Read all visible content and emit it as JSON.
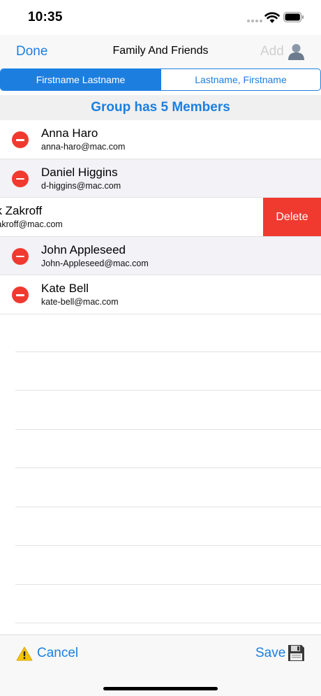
{
  "status_bar": {
    "time": "10:35"
  },
  "nav": {
    "done_label": "Done",
    "title": "Family And Friends",
    "add_label": "Add"
  },
  "sort_segments": [
    {
      "label": "Firstname Lastname",
      "selected": true
    },
    {
      "label": "Lastname, Firstname",
      "selected": false
    }
  ],
  "group": {
    "header": "Group has 5 Members"
  },
  "members": [
    {
      "name": "Anna Haro",
      "email": "anna-haro@mac.com"
    },
    {
      "name": "Daniel Higgins",
      "email": "d-higgins@mac.com"
    },
    {
      "name": "nk Zakroff",
      "email": "-zakroff@mac.com",
      "delete_label": "Delete"
    },
    {
      "name": "John Appleseed",
      "email": "John-Appleseed@mac.com"
    },
    {
      "name": "Kate Bell",
      "email": "kate-bell@mac.com"
    }
  ],
  "toolbar": {
    "cancel_label": "Cancel",
    "save_label": "Save"
  },
  "colors": {
    "accent": "#1c7fe0",
    "destructive": "#f03a30",
    "disabled": "#cfcfcf"
  }
}
